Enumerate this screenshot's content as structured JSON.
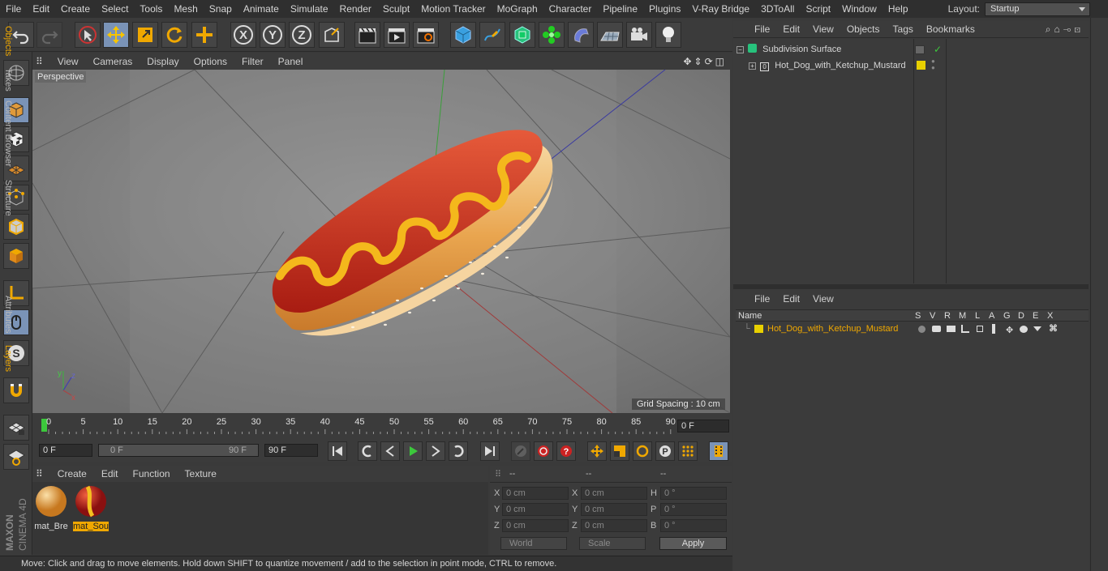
{
  "menubar": {
    "items": [
      "File",
      "Edit",
      "Create",
      "Select",
      "Tools",
      "Mesh",
      "Snap",
      "Animate",
      "Simulate",
      "Render",
      "Sculpt",
      "Motion Tracker",
      "MoGraph",
      "Character",
      "Pipeline",
      "Plugins",
      "V-Ray Bridge",
      "3DToAll",
      "Script",
      "Window",
      "Help"
    ],
    "layout_label": "Layout:",
    "layout_value": "Startup"
  },
  "toolbar": {
    "axis_x": "X",
    "axis_y": "Y",
    "axis_z": "Z"
  },
  "viewport": {
    "menu": [
      "View",
      "Cameras",
      "Display",
      "Options",
      "Filter",
      "Panel"
    ],
    "label": "Perspective",
    "grid_spacing": "Grid Spacing : 10 cm",
    "axis_x": "x",
    "axis_y": "y",
    "axis_z": "z"
  },
  "timeline": {
    "ticks": [
      "0",
      "5",
      "10",
      "15",
      "20",
      "25",
      "30",
      "35",
      "40",
      "45",
      "50",
      "55",
      "60",
      "65",
      "70",
      "75",
      "80",
      "85",
      "90"
    ],
    "current_frame": "0 F",
    "start_field": "0 F",
    "range_start": "0 F",
    "range_end": "90 F",
    "end_field": "90 F"
  },
  "material_manager": {
    "menu": [
      "Create",
      "Edit",
      "Function",
      "Texture"
    ],
    "materials": [
      {
        "name": "mat_Bre",
        "selected": false
      },
      {
        "name": "mat_Sou",
        "selected": true
      }
    ]
  },
  "coordinates": {
    "header": [
      "--",
      "--",
      "--"
    ],
    "rows": [
      {
        "a": "X",
        "av": "0 cm",
        "b": "X",
        "bv": "0 cm",
        "c": "H",
        "cv": "0 °"
      },
      {
        "a": "Y",
        "av": "0 cm",
        "b": "Y",
        "bv": "0 cm",
        "c": "P",
        "cv": "0 °"
      },
      {
        "a": "Z",
        "av": "0 cm",
        "b": "Z",
        "bv": "0 cm",
        "c": "B",
        "cv": "0 °"
      }
    ],
    "world": "World",
    "scale": "Scale",
    "apply": "Apply"
  },
  "status": "Move: Click and drag to move elements. Hold down SHIFT to quantize movement / add to the selection in point mode, CTRL to remove.",
  "object_manager": {
    "menu": [
      "File",
      "Edit",
      "View",
      "Objects",
      "Tags",
      "Bookmarks"
    ],
    "objects": [
      {
        "name": "Subdivision Surface"
      },
      {
        "name": "Hot_Dog_with_Ketchup_Mustard"
      }
    ]
  },
  "layer_manager": {
    "menu": [
      "File",
      "Edit",
      "View"
    ],
    "columns": [
      "Name",
      "S",
      "V",
      "R",
      "M",
      "L",
      "A",
      "G",
      "D",
      "E",
      "X"
    ],
    "layer": "Hot_Dog_with_Ketchup_Mustard"
  },
  "right_tabs": [
    "Objects",
    "Takes",
    "Content Browser",
    "Structure",
    "Attributes",
    "Layers"
  ],
  "brand": {
    "maxon": "MAXON",
    "cinema": "CINEMA 4D"
  },
  "colors": {
    "accent": "#f0a800",
    "active": "#7a93b7",
    "layer": "#e8d000"
  }
}
